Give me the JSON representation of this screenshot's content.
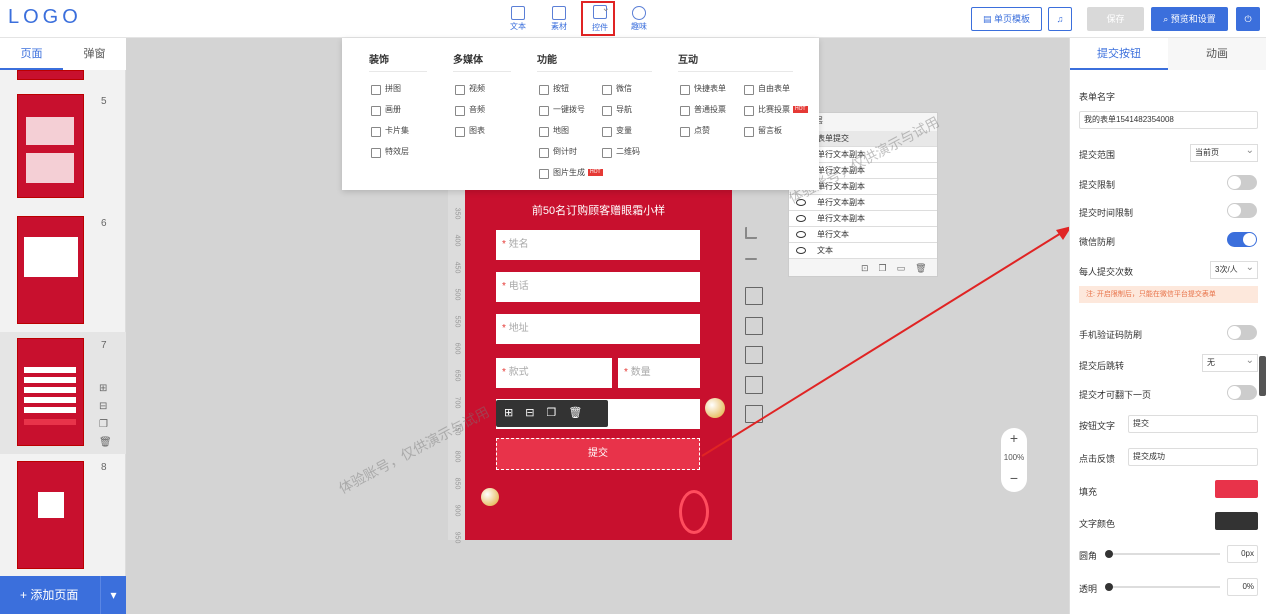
{
  "header": {
    "logo": "LOGO",
    "tools": [
      {
        "label": "文本"
      },
      {
        "label": "素材"
      },
      {
        "label": "控件"
      },
      {
        "label": "趣味"
      }
    ],
    "single_page_template": "单页模板",
    "btn_music_icon": "music-icon",
    "btn_save": "保存",
    "btn_preview": "预览和设置"
  },
  "left": {
    "tab_pages": "页面",
    "tab_popups": "弹窗",
    "pages": [
      {
        "num": "5"
      },
      {
        "num": "6"
      },
      {
        "num": "7"
      },
      {
        "num": "8"
      }
    ],
    "add_page": "+ 添加页面"
  },
  "menu": {
    "categories": [
      "装饰",
      "多媒体",
      "功能",
      "互动"
    ],
    "decor": [
      "拼图",
      "画册",
      "卡片集",
      "特效层"
    ],
    "media": [
      "视频",
      "音频",
      "图表"
    ],
    "func_col1": [
      "按钮",
      "一键拨号",
      "地图",
      "倒计时",
      "图片生成"
    ],
    "func_col2": [
      "微信",
      "导航",
      "变量",
      "二维码"
    ],
    "interact_col1": [
      "快捷表单",
      "普通投票",
      "点赞"
    ],
    "interact_col2": [
      "自由表单",
      "比赛投票",
      "留言板"
    ],
    "hot_tag": "HOT"
  },
  "canvas": {
    "banner": "前50名订购顾客赠眼霜小样",
    "fields": {
      "name": "姓名",
      "phone": "电话",
      "address": "地址",
      "style": "款式",
      "qty": "数量"
    },
    "req": "*",
    "submit": "提交",
    "ruler": [
      "350",
      "400",
      "450",
      "500",
      "550",
      "600",
      "650",
      "700",
      "750",
      "800",
      "850",
      "900",
      "950"
    ]
  },
  "layers": {
    "title": "图层",
    "rows": [
      "表单提交",
      "单行文本副本",
      "单行文本副本",
      "单行文本副本",
      "单行文本副本",
      "单行文本副本",
      "单行文本",
      "文本"
    ]
  },
  "zoom": {
    "plus": "+",
    "level": "100%",
    "minus": "−"
  },
  "watermark": "体验账号，仅供演示与试用",
  "right": {
    "tab_submit": "提交按钮",
    "tab_anim": "动画",
    "form_name_label": "表单名字",
    "form_name": "我的表单1541482354008",
    "scope_label": "提交范围",
    "scope_value": "当前页",
    "limit_label": "提交限制",
    "time_limit_label": "提交时间限制",
    "wechat_label": "微信防刷",
    "per_person_label": "每人提交次数",
    "per_person_value": "3次/人",
    "notice": "注: 开启限制后，只能在微信平台提交表单",
    "sms_label": "手机验证码防刷",
    "jump_label": "提交后跳转",
    "jump_value": "无",
    "next_label": "提交才可翻下一页",
    "btn_text_label": "按钮文字",
    "btn_text": "提交",
    "feedback_label": "点击反馈",
    "feedback": "提交成功",
    "fill_label": "填充",
    "fill_color": "#e8334a",
    "text_color_label": "文字颜色",
    "text_color": "#333333",
    "radius_label": "圆角",
    "radius": "0px",
    "opacity_label": "透明",
    "opacity": "0%"
  }
}
